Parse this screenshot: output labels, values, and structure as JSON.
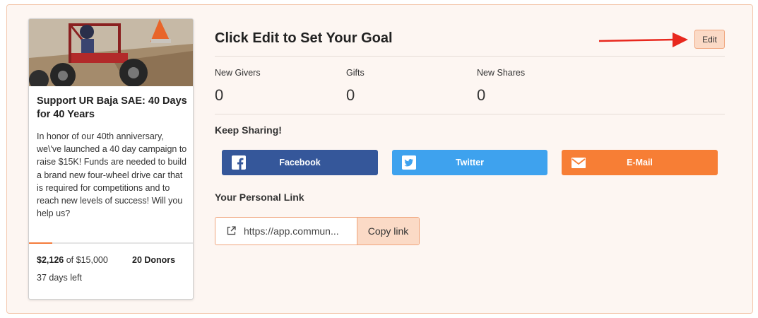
{
  "campaign": {
    "title": "Support UR Baja SAE: 40 Days for 40 Years",
    "description": "In honor of our 40th anniversary, we\\'ve launched a 40 day campaign to raise $15K! Funds are needed to build a brand new four-wheel drive car that is required for competitions and to reach new levels of success! Will you help us?",
    "raised": "$2,126",
    "goal_text": "of $15,000",
    "progress_fraction": 0.142,
    "donors": "20 Donors",
    "days_number": "37",
    "days_suffix": "days left",
    "photo_icon": "baja-car-photo"
  },
  "goal": {
    "title": "Click Edit to Set Your Goal",
    "edit_label": "Edit",
    "arrow_icon": "red-arrow-icon"
  },
  "metrics": [
    {
      "label": "New Givers",
      "value": "0"
    },
    {
      "label": "Gifts",
      "value": "0"
    },
    {
      "label": "New Shares",
      "value": "0"
    }
  ],
  "sharing": {
    "heading": "Keep Sharing!",
    "facebook": {
      "label": "Facebook",
      "icon": "facebook-icon",
      "color": "#35579a"
    },
    "twitter": {
      "label": "Twitter",
      "icon": "twitter-icon",
      "color": "#3ea2ee"
    },
    "email": {
      "label": "E-Mail",
      "icon": "mail-icon",
      "color": "#f77e35"
    }
  },
  "personal_link": {
    "heading": "Your Personal Link",
    "value": "https://app.commun...",
    "copy_label": "Copy link",
    "icon": "external-link-icon"
  },
  "colors": {
    "accent": "#f47c3c",
    "panel_background": "#fdf6f2",
    "panel_border": "#f4c8ad"
  }
}
